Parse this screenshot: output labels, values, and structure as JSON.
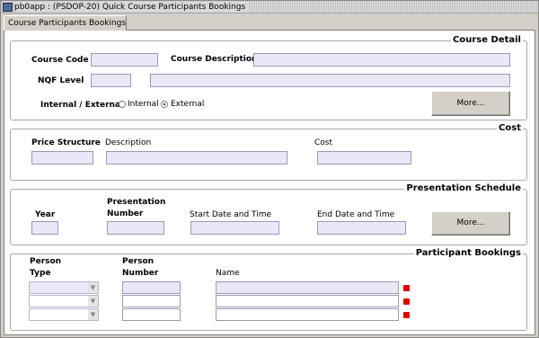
{
  "window": {
    "title": "pb0app : (PSDOP-20) Quick Course Participants Bookings"
  },
  "tab": {
    "label": "Course Participants Bookings"
  },
  "course_detail": {
    "title": "Course Detail",
    "course_code_label": "Course Code",
    "course_description_label": "Course Description",
    "nqf_level_label": "NQF Level",
    "internal_external_label": "Internal / External",
    "internal_option": "Internal",
    "external_option": "External",
    "selected": "External",
    "more_button": "More..."
  },
  "cost": {
    "title": "Cost",
    "price_structure_label": "Price Structure",
    "description_label": "Description",
    "cost_label": "Cost"
  },
  "presentation": {
    "title": "Presentation Schedule",
    "year_label": "Year",
    "number_label_line1": "Presentation",
    "number_label_line2": "Number",
    "start_label": "Start Date and Time",
    "end_label": "End Date and Time",
    "more_button": "More..."
  },
  "participants": {
    "title": "Participant Bookings",
    "person_type_line1": "Person",
    "person_type_line2": "Type",
    "person_number_line1": "Person",
    "person_number_line2": "Number",
    "name_label": "Name",
    "rows": [
      {
        "type": "",
        "number": "",
        "name": ""
      },
      {
        "type": "",
        "number": "",
        "name": ""
      },
      {
        "type": "",
        "number": "",
        "name": ""
      }
    ]
  },
  "colors": {
    "field": "#e8e8f8",
    "required": "#e00000",
    "window": "#d4d0c8"
  }
}
